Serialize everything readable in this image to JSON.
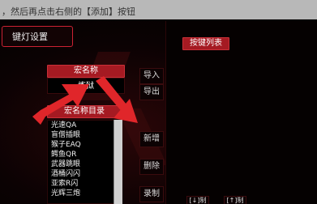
{
  "instruction": "，然后再点击右侧的【添加】按钮",
  "light_setting_label": "键灯设置",
  "keys_list_header": "按键列表",
  "macro_name_header": "宏名称",
  "macro_name_value": "炼狱",
  "macro_dir_header": "宏名称目录",
  "side_buttons": {
    "import": "导入",
    "export": "导出",
    "new": "新增",
    "delete": "删除",
    "record": "录制"
  },
  "macro_list": [
    "光速QA",
    "盲僧插眼",
    "猴子EAQ",
    "鳄鱼QR",
    "武器跳眼",
    "酒桶闪闪",
    "亚索R闪",
    "光辉三炮"
  ],
  "bottom_buttons": [
    "[↓]制",
    "[↑]制"
  ],
  "colors": {
    "accent": "#a51a22",
    "arrow": "#e0262a"
  }
}
